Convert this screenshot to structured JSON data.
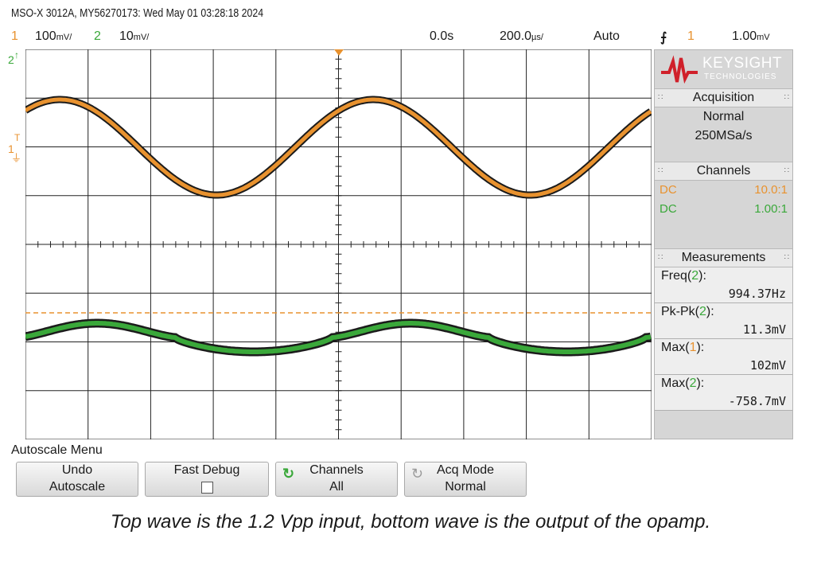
{
  "title": "MSO-X 3012A, MY56270173: Wed May 01 03:28:18 2024",
  "header": {
    "ch1_num": "1",
    "ch1_scale": "100",
    "ch1_scale_unit": "mV/",
    "ch2_num": "2",
    "ch2_scale": "10",
    "ch2_scale_unit": "mV/",
    "time_offset": "0.0s",
    "timebase": "200.0",
    "timebase_unit": "µs/",
    "trigger_mode": "Auto",
    "trigger_ch": "1",
    "trigger_level": "1.00",
    "trigger_level_unit": "mV"
  },
  "brand": {
    "name": "KEYSIGHT",
    "sub": "TECHNOLOGIES"
  },
  "acquisition": {
    "header": "Acquisition",
    "mode": "Normal",
    "rate": "250MSa/s"
  },
  "channels": {
    "header": "Channels",
    "rows": [
      {
        "coupling": "DC",
        "probe": "10.0:1"
      },
      {
        "coupling": "DC",
        "probe": "1.00:1"
      }
    ]
  },
  "measurements": {
    "header": "Measurements",
    "items": [
      {
        "name": "Freq",
        "ch": "2",
        "value": "994.37Hz"
      },
      {
        "name": "Pk-Pk",
        "ch": "2",
        "value": "11.3mV"
      },
      {
        "name": "Max",
        "ch": "1",
        "value": "102mV"
      },
      {
        "name": "Max",
        "ch": "2",
        "value": "-758.7mV"
      }
    ]
  },
  "left_markers": {
    "ch2": "2",
    "ch1": "1",
    "trig": "T"
  },
  "menu": {
    "title": "Autoscale Menu",
    "softkeys": [
      {
        "line1": "Undo",
        "line2": "Autoscale",
        "icon": "none"
      },
      {
        "line1": "Fast Debug",
        "line2": "",
        "icon": "checkbox-icon"
      },
      {
        "line1": "Channels",
        "line2": "All",
        "icon": "green-refresh-icon"
      },
      {
        "line1": "Acq Mode",
        "line2": "Normal",
        "icon": "gray-refresh-icon"
      }
    ]
  },
  "caption": "Top wave is the 1.2 Vpp input, bottom wave is the output of the opamp.",
  "colors": {
    "ch1": "#e8922f",
    "ch2": "#3aa83a",
    "panel": "#d6d6d6"
  }
}
